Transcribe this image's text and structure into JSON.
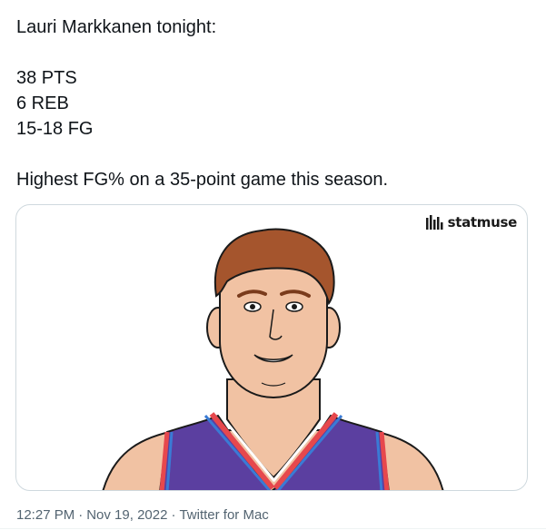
{
  "tweet": {
    "lines": [
      "Lauri Markkanen tonight:",
      "",
      "38 PTS",
      "6 REB",
      "15-18 FG",
      "",
      "Highest FG% on a 35-point game this season."
    ]
  },
  "media": {
    "brand": "statmuse",
    "brand_icon": "statmuse-logo-icon",
    "subject_icon": "player-portrait-illustration",
    "jersey_color": "#5b3fa0",
    "trim_colors": [
      "#e6484d",
      "#3a7bd5",
      "#ffffff"
    ]
  },
  "meta": {
    "time": "12:27 PM",
    "separator": "·",
    "date": "Nov 19, 2022",
    "source": "Twitter for Mac"
  }
}
